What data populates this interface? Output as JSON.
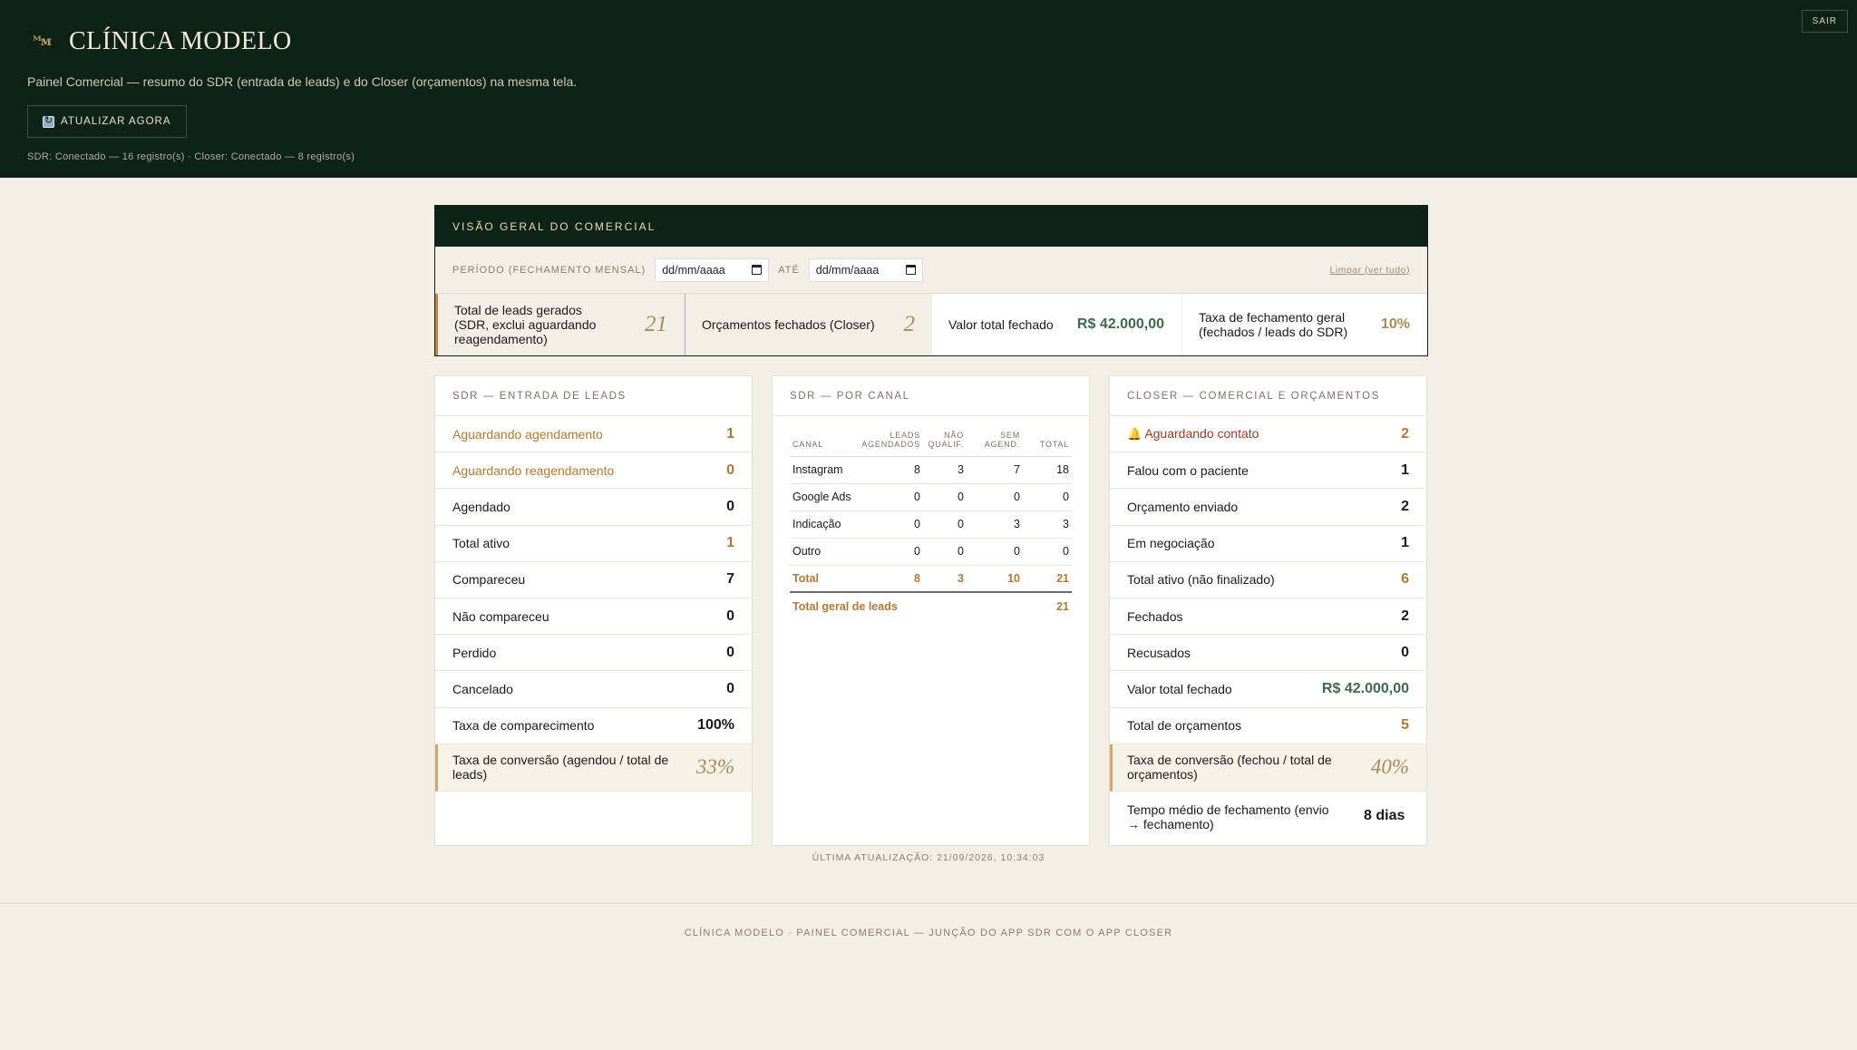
{
  "header": {
    "brand_mark": "ᴹᴍ",
    "brand_title": "CLÍNICA MODELO",
    "subtitle": "Painel Comercial — resumo do SDR (entrada de leads) e do Closer (orçamentos) na mesma tela.",
    "refresh_label": "ATUALIZAR AGORA",
    "status_line": "SDR: Conectado — 16 registro(s) · Closer: Conectado — 8 registro(s)",
    "logout_label": "SAIR"
  },
  "overview": {
    "title": "VISÃO GERAL DO COMERCIAL",
    "period_label": "PERÍODO (FECHAMENTO MENSAL)",
    "date_from_placeholder": "dd/mm/aaaa",
    "until_label": "ATÉ",
    "date_to_placeholder": "dd/mm/aaaa",
    "clear_label": "Limpar (ver tudo)",
    "kpis": [
      {
        "label": "Total de leads gerados (SDR, exclui aguardando reagendamento)",
        "value": "21"
      },
      {
        "label": "Orçamentos fechados (Closer)",
        "value": "2"
      },
      {
        "label": "Valor total fechado",
        "value": "R$ 42.000,00"
      },
      {
        "label": "Taxa de fechamento geral (fechados / leads do SDR)",
        "value": "10%"
      }
    ]
  },
  "sdr": {
    "title": "SDR — ENTRADA DE LEADS",
    "rows": [
      {
        "label": "Aguardando agendamento",
        "value": "1"
      },
      {
        "label": "Aguardando reagendamento",
        "value": "0"
      },
      {
        "label": "Agendado",
        "value": "0"
      },
      {
        "label": "Total ativo",
        "value": "1"
      },
      {
        "label": "Compareceu",
        "value": "7"
      },
      {
        "label": "Não compareceu",
        "value": "0"
      },
      {
        "label": "Perdido",
        "value": "0"
      },
      {
        "label": "Cancelado",
        "value": "0"
      },
      {
        "label": "Taxa de comparecimento",
        "value": "100%"
      },
      {
        "label": "Taxa de conversão (agendou / total de leads)",
        "value": "33%"
      }
    ]
  },
  "channel": {
    "title": "SDR — POR CANAL",
    "headers": [
      "CANAL",
      "LEADS AGENDADOS",
      "NÃO QUALIF.",
      "SEM AGEND.",
      "TOTAL"
    ],
    "rows": [
      [
        "Instagram",
        "8",
        "3",
        "7",
        "18"
      ],
      [
        "Google Ads",
        "0",
        "0",
        "0",
        "0"
      ],
      [
        "Indicação",
        "0",
        "0",
        "3",
        "3"
      ],
      [
        "Outro",
        "0",
        "0",
        "0",
        "0"
      ]
    ],
    "total_row": [
      "Total",
      "8",
      "3",
      "10",
      "21"
    ],
    "grand_label": "Total geral de leads",
    "grand_value": "21"
  },
  "closer": {
    "title": "CLOSER — COMERCIAL E ORÇAMENTOS",
    "bell_icon": "🔔",
    "rows": [
      {
        "label": "Aguardando contato",
        "value": "2"
      },
      {
        "label": "Falou com o paciente",
        "value": "1"
      },
      {
        "label": "Orçamento enviado",
        "value": "2"
      },
      {
        "label": "Em negociação",
        "value": "1"
      },
      {
        "label": "Total ativo (não finalizado)",
        "value": "6"
      },
      {
        "label": "Fechados",
        "value": "2"
      },
      {
        "label": "Recusados",
        "value": "0"
      },
      {
        "label": "Valor total fechado",
        "value": "R$ 42.000,00"
      },
      {
        "label": "Total de orçamentos",
        "value": "5"
      },
      {
        "label": "Taxa de conversão (fechou / total de orçamentos)",
        "value": "40%"
      },
      {
        "label": "Tempo médio de fechamento (envio → fechamento)",
        "value": "8 dias"
      }
    ]
  },
  "last_update": "ÚLTIMA ATUALIZAÇÃO: 21/09/2026, 10:34:03",
  "footer": "CLÍNICA MODELO · PAINEL COMERCIAL — JUNÇÃO DO APP SDR COM O APP CLOSER",
  "colors": {
    "dark_green": "#0f2218",
    "gold": "#b07a36",
    "cream": "#f4efe6",
    "money_green": "#3d6b4d"
  }
}
